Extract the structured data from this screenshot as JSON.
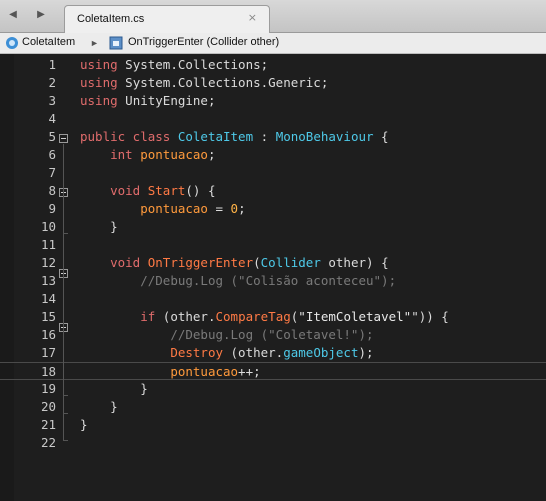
{
  "tabbar": {
    "tab_label": "ColetaItem.cs",
    "close_glyph": "×",
    "back_glyph": "◀",
    "forward_glyph": "▶"
  },
  "breadcrumb": {
    "class_name": "ColetaItem",
    "separator": "►",
    "member": "OnTriggerEnter (Collider other)"
  },
  "editor": {
    "current_line": 18,
    "lines": [
      {
        "n": "1",
        "tokens": [
          [
            "kw",
            "using"
          ],
          [
            "pl",
            " System.Collections;"
          ]
        ]
      },
      {
        "n": "2",
        "tokens": [
          [
            "kw",
            "using"
          ],
          [
            "pl",
            " System.Collections.Generic;"
          ]
        ]
      },
      {
        "n": "3",
        "tokens": [
          [
            "kw",
            "using"
          ],
          [
            "pl",
            " UnityEngine;"
          ]
        ]
      },
      {
        "n": "4",
        "tokens": []
      },
      {
        "n": "5",
        "tokens": [
          [
            "kw",
            "public class"
          ],
          [
            "pl",
            " "
          ],
          [
            "ty",
            "ColetaItem"
          ],
          [
            "pl",
            " : "
          ],
          [
            "ty",
            "MonoBehaviour"
          ],
          [
            "pl",
            " {"
          ]
        ]
      },
      {
        "n": "6",
        "tokens": [
          [
            "pl",
            "    "
          ],
          [
            "kw",
            "int"
          ],
          [
            "pl",
            " "
          ],
          [
            "fld",
            "pontuacao"
          ],
          [
            "pl",
            ";"
          ]
        ]
      },
      {
        "n": "7",
        "tokens": []
      },
      {
        "n": "8",
        "tokens": [
          [
            "pl",
            "    "
          ],
          [
            "kw",
            "void"
          ],
          [
            "pl",
            " "
          ],
          [
            "fn",
            "Start"
          ],
          [
            "pl",
            "() {"
          ]
        ]
      },
      {
        "n": "9",
        "tokens": [
          [
            "pl",
            "        "
          ],
          [
            "fld",
            "pontuacao"
          ],
          [
            "pl",
            " = "
          ],
          [
            "num",
            "0"
          ],
          [
            "pl",
            ";"
          ]
        ]
      },
      {
        "n": "10",
        "tokens": [
          [
            "pl",
            "    }"
          ]
        ]
      },
      {
        "n": "11",
        "tokens": []
      },
      {
        "n": "12",
        "tokens": [
          [
            "pl",
            "    "
          ],
          [
            "kw",
            "void"
          ],
          [
            "pl",
            " "
          ],
          [
            "fn",
            "OnTriggerEnter"
          ],
          [
            "pl",
            "("
          ],
          [
            "ty",
            "Collider"
          ],
          [
            "pl",
            " other) {"
          ]
        ]
      },
      {
        "n": "13",
        "tokens": [
          [
            "pl",
            "        "
          ],
          [
            "cm",
            "//Debug.Log (\"Colisão aconteceu\");"
          ]
        ]
      },
      {
        "n": "14",
        "tokens": []
      },
      {
        "n": "15",
        "tokens": [
          [
            "pl",
            "        "
          ],
          [
            "kw",
            "if"
          ],
          [
            "pl",
            " (other."
          ],
          [
            "fn",
            "CompareTag"
          ],
          [
            "pl",
            "("
          ],
          [
            "str",
            "\"ItemColetavel\""
          ],
          [
            "pl",
            "\")) {"
          ]
        ]
      },
      {
        "n": "16",
        "tokens": [
          [
            "pl",
            "            "
          ],
          [
            "cm",
            "//Debug.Log (\"Coletavel!\");"
          ]
        ]
      },
      {
        "n": "17",
        "tokens": [
          [
            "pl",
            "            "
          ],
          [
            "fn",
            "Destroy"
          ],
          [
            "pl",
            " (other."
          ],
          [
            "ty",
            "gameObject"
          ],
          [
            "pl",
            ");"
          ]
        ]
      },
      {
        "n": "18",
        "tokens": [
          [
            "pl",
            "            "
          ],
          [
            "fld",
            "pontuacao"
          ],
          [
            "pl",
            "++;"
          ]
        ]
      },
      {
        "n": "19",
        "tokens": [
          [
            "pl",
            "        }"
          ]
        ]
      },
      {
        "n": "20",
        "tokens": [
          [
            "pl",
            "    }"
          ]
        ]
      },
      {
        "n": "21",
        "tokens": [
          [
            "pl",
            "}"
          ]
        ]
      },
      {
        "n": "22",
        "tokens": []
      }
    ]
  }
}
